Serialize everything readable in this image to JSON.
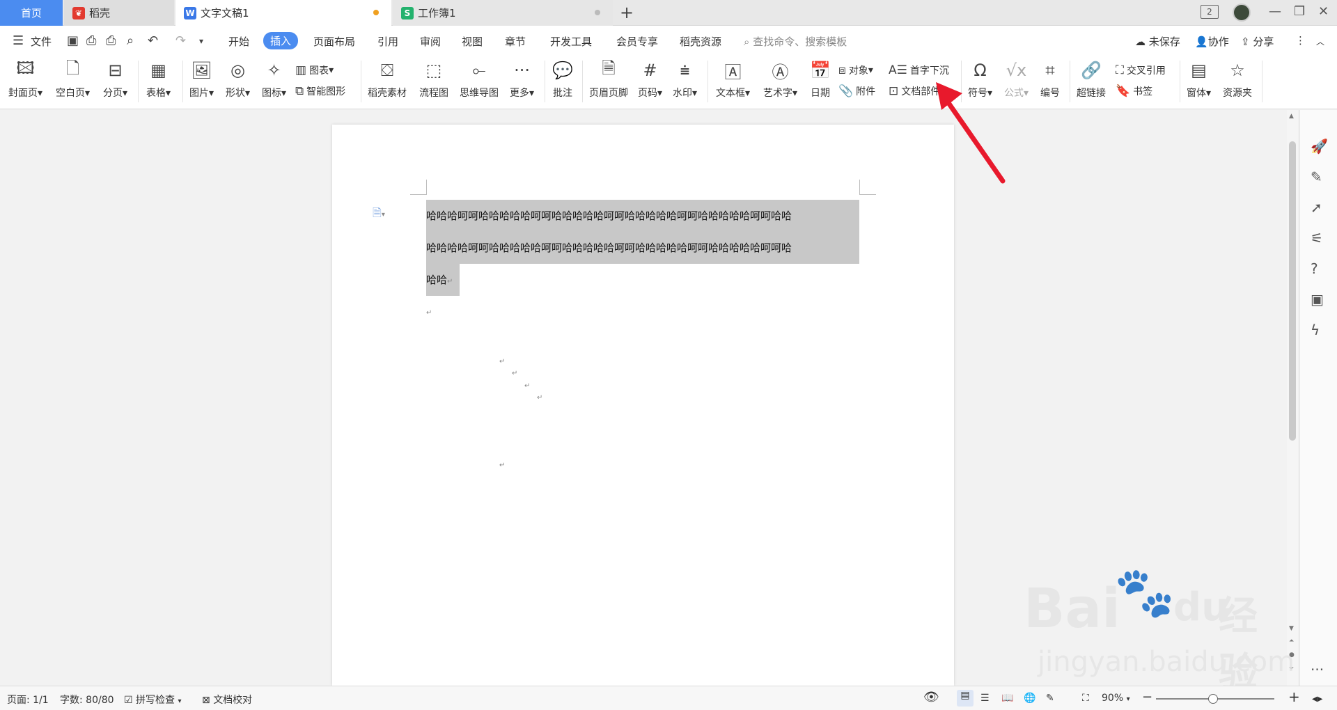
{
  "tabs": {
    "home": "首页",
    "daoke": "稻壳",
    "doc": "文字文稿1",
    "sheet": "工作簿1",
    "doc_icon": "W",
    "sheet_icon": "S",
    "add": "+",
    "window_badge": "2"
  },
  "menu": {
    "file": "文件",
    "tabs": [
      "开始",
      "插入",
      "页面布局",
      "引用",
      "审阅",
      "视图",
      "章节",
      "开发工具",
      "会员专享",
      "稻壳资源"
    ],
    "active_tab": "插入",
    "search_placeholder": "查找命令、搜索模板",
    "unsaved": "未保存",
    "collab": "协作",
    "share": "分享"
  },
  "ribbon": {
    "cover": "封面页",
    "blank": "空白页",
    "pagebreak": "分页",
    "table": "表格",
    "picture": "图片",
    "shape": "形状",
    "iconlib": "图标",
    "chart": "图表",
    "smartart": "智能图形",
    "material": "稻壳素材",
    "flowchart": "流程图",
    "mindmap": "思维导图",
    "more": "更多",
    "comment": "批注",
    "header_footer": "页眉页脚",
    "page_number": "页码",
    "watermark": "水印",
    "textbox": "文本框",
    "wordart": "艺术字",
    "date": "日期",
    "object": "对象",
    "attachment": "附件",
    "dropcap": "首字下沉",
    "docpart": "文档部件",
    "symbol": "符号",
    "formula": "公式",
    "numbering": "编号",
    "hyperlink": "超链接",
    "crossref": "交叉引用",
    "bookmark": "书签",
    "form": "窗体",
    "resource": "资源夹"
  },
  "document": {
    "lines": [
      "哈哈哈呵呵哈哈哈哈哈呵呵哈哈哈哈哈呵呵哈哈哈哈哈呵呵哈哈哈哈哈呵呵哈哈",
      "哈哈哈哈呵呵哈哈哈哈哈呵呵哈哈哈哈哈呵呵哈哈哈哈哈呵呵哈哈哈哈哈呵呵哈",
      "哈哈"
    ],
    "para_mark": "↵"
  },
  "status": {
    "page": "页面: 1/1",
    "words": "字数: 80/80",
    "spell": "拼写检查",
    "proof": "文档校对",
    "zoom": "90%"
  },
  "watermark": {
    "brand": "Bai",
    "brand2": "du",
    "cn": "经验",
    "url": "jingyan.baidu.com"
  },
  "colors": {
    "accent": "#4b8cf0",
    "selection": "#c8c8c8",
    "arrow": "#e8192c",
    "doc_icon": "#3a78e7",
    "sheet_icon": "#23b26d",
    "daoke_icon": "#e23a2f"
  }
}
